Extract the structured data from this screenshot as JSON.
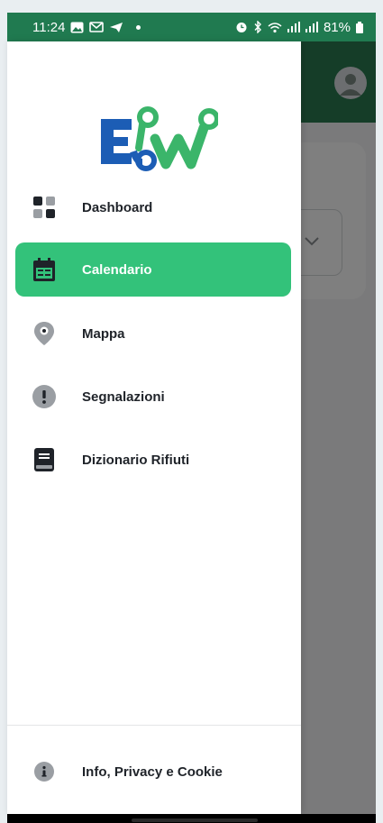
{
  "status_bar": {
    "time": "11:24",
    "battery": "81%",
    "icons_left": [
      "gallery-icon",
      "mail-icon",
      "telegram-icon",
      "notification-dot"
    ],
    "icons_right": [
      "alarm-icon",
      "bluetooth-icon",
      "wifi-icon",
      "signal-icon",
      "signal-icon",
      "battery-icon"
    ]
  },
  "colors": {
    "primary": "#207a50",
    "active_item": "#33c27a",
    "logo_blue": "#1c5db5",
    "logo_green": "#3bb56a"
  },
  "drawer": {
    "logo_alt": "EW",
    "items": [
      {
        "label": "Dashboard",
        "icon": "dashboard-grid-icon",
        "active": false
      },
      {
        "label": "Calendario",
        "icon": "calendar-icon",
        "active": true
      },
      {
        "label": "Mappa",
        "icon": "map-pin-icon",
        "active": false
      },
      {
        "label": "Segnalazioni",
        "icon": "alert-icon",
        "active": false
      },
      {
        "label": "Dizionario Rifiuti",
        "icon": "book-icon",
        "active": false
      }
    ],
    "footer": {
      "label": "Info, Privacy e Cookie",
      "icon": "info-icon"
    }
  }
}
